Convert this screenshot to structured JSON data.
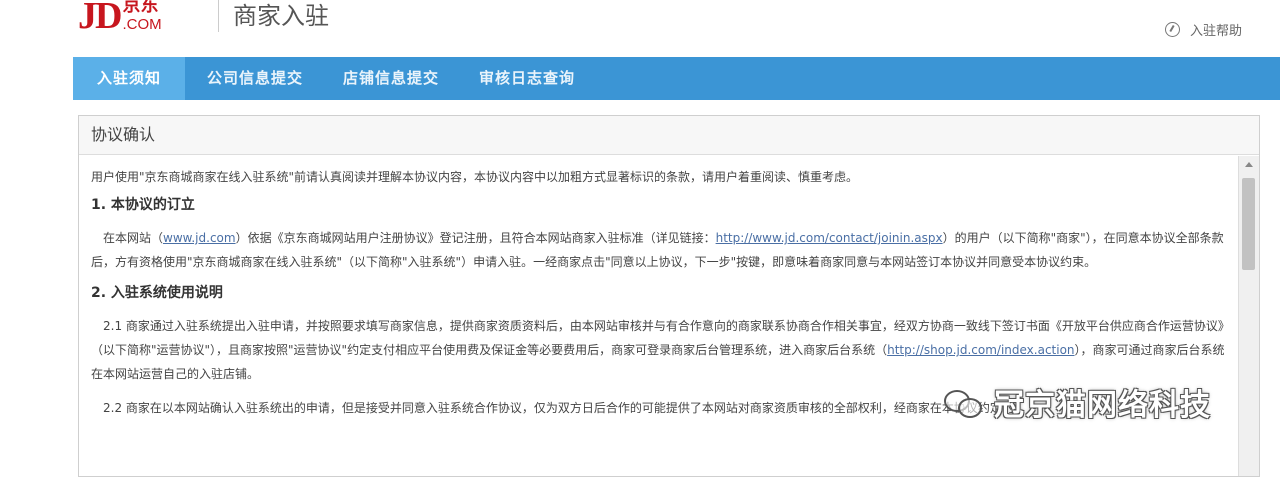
{
  "header": {
    "logo_jd": "JD",
    "logo_cn": "京东",
    "logo_com": ".COM",
    "site_title": "商家入驻",
    "help_link": "入驻帮助"
  },
  "nav": {
    "tabs": [
      {
        "label": "入驻须知",
        "active": true
      },
      {
        "label": "公司信息提交",
        "active": false
      },
      {
        "label": "店铺信息提交",
        "active": false
      },
      {
        "label": "审核日志查询",
        "active": false
      }
    ]
  },
  "agreement": {
    "title": "协议确认",
    "intro": "用户使用\"京东商城商家在线入驻系统\"前请认真阅读并理解本协议内容，本协议内容中以加粗方式显著标识的条款，请用户着重阅读、慎重考虑。",
    "section1_title": "1. 本协议的订立",
    "section1_p1_a": "在本网站（",
    "section1_link1": "www.jd.com",
    "section1_p1_b": "）依据《京东商城网站用户注册协议》登记注册，且符合本网站商家入驻标准（详见链接：",
    "section1_link2": "http://www.jd.com/contact/joinin.aspx",
    "section1_p1_c": "）的用户（以下简称\"商家\"），在同意本协议全部条款后，方有资格使用\"京东商城商家在线入驻系统\"（以下简称\"入驻系统\"）申请入驻。一经商家点击\"同意以上协议，下一步\"按键，即意味着商家同意与本网站签订本协议并同意受本协议约束。",
    "section2_title": "2. 入驻系统使用说明",
    "section2_p1_a": "2.1 商家通过入驻系统提出入驻申请，并按照要求填写商家信息，提供商家资质资料后，由本网站审核并与有合作意向的商家联系协商合作相关事宜，经双方协商一致线下签订书面《开放平台供应商合作运营协议》（以下简称\"运营协议\"），且商家按照\"运营协议\"约定支付相应平台使用费及保证金等必要费用后，商家可登录商家后台管理系统，进入商家后台系统",
    "section2_p1_link": "http://shop.jd.com/index.action",
    "section2_p1_b": "），商家可通过商家后台系统在本网站运营自己的入驻店铺。",
    "section2_p2": "2.2 商家在以本网站确认入驻系统出的申请，但是接受并同意入驻系统合作协议，仅为双方日后合作的可能提供了本网站对商家资质审核的全部权利，经商家在本协议约定的"
  },
  "watermark": {
    "text": "冠京猫网络科技"
  },
  "colors": {
    "nav_bg": "#3b95d5",
    "nav_active": "#5bb0e8",
    "brand_red": "#c7161e"
  }
}
